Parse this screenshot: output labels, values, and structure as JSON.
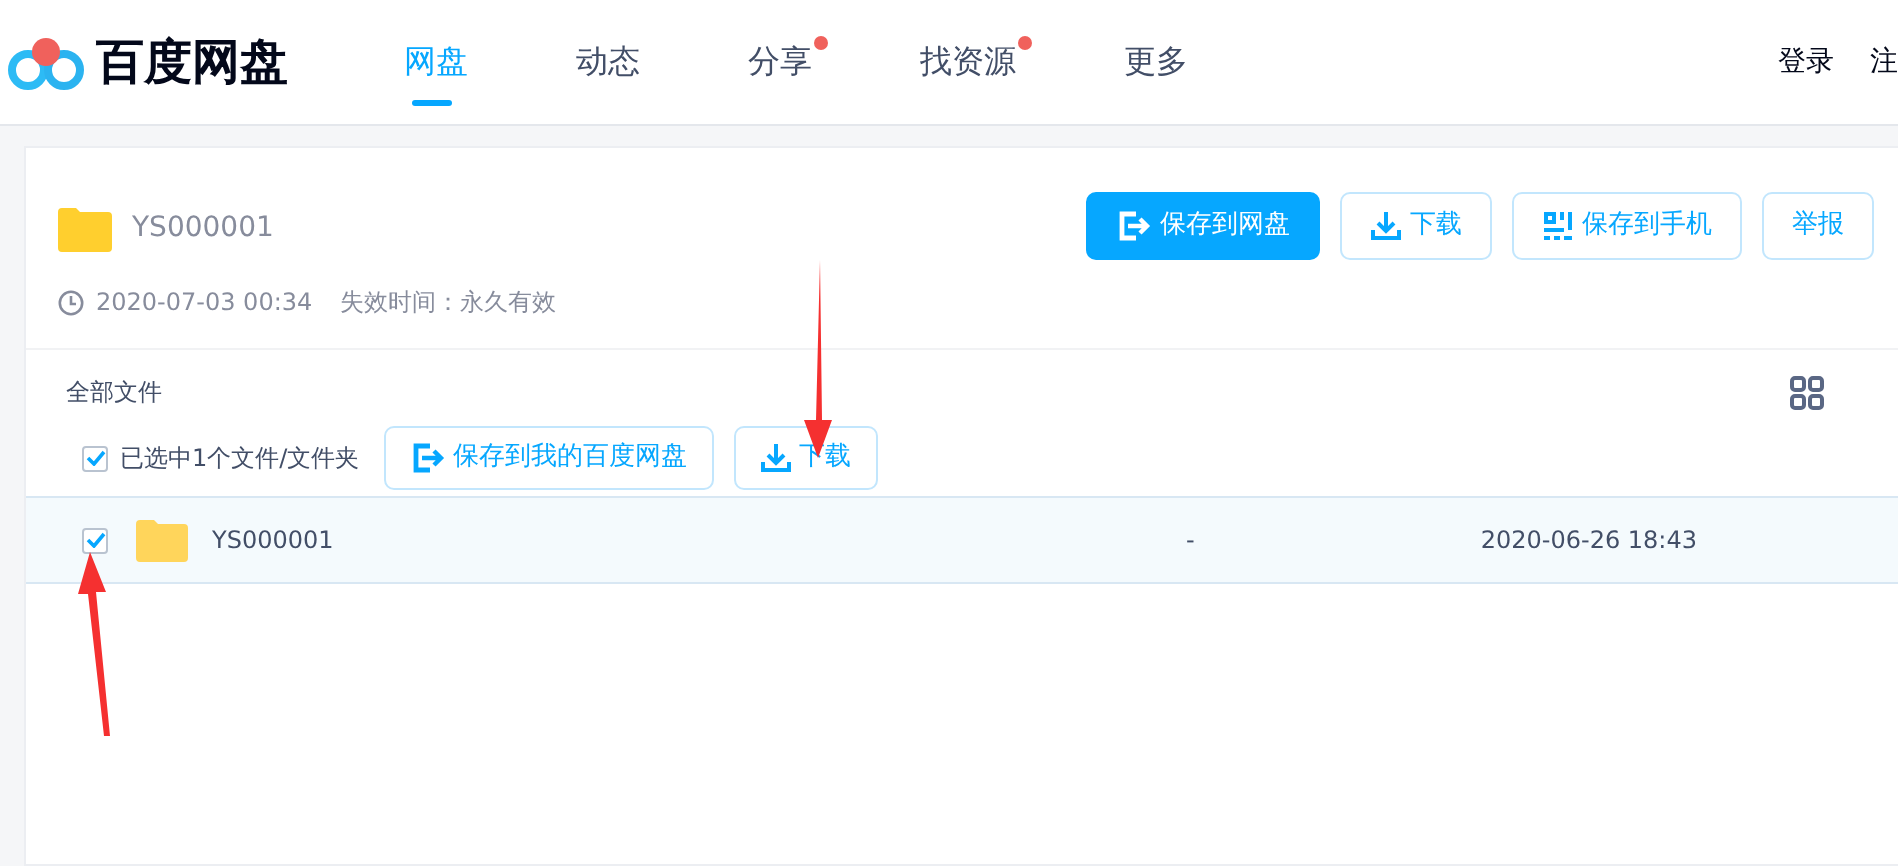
{
  "brand": "百度网盘",
  "nav": [
    {
      "label": "网盘",
      "selected": true,
      "dot": false
    },
    {
      "label": "动态",
      "selected": false,
      "dot": false
    },
    {
      "label": "分享",
      "selected": false,
      "dot": true
    },
    {
      "label": "找资源",
      "selected": false,
      "dot": true
    },
    {
      "label": "更多",
      "selected": false,
      "dot": false
    }
  ],
  "user_links": [
    "登录",
    "注"
  ],
  "share": {
    "name": "YS000001",
    "time": "2020-07-03 00:34",
    "expiry": "失效时间：永久有效",
    "actions": [
      {
        "label": "保存到网盘",
        "kind": "save",
        "primary": true
      },
      {
        "label": "下载",
        "kind": "download",
        "primary": false
      },
      {
        "label": "保存到手机",
        "kind": "qr",
        "primary": false
      },
      {
        "label": "举报",
        "kind": "plain",
        "primary": false
      }
    ]
  },
  "breadcrumb": "全部文件",
  "selection": {
    "checked": true,
    "label": "已选中1个文件/文件夹",
    "actions": [
      {
        "label": "保存到我的百度网盘",
        "kind": "save"
      },
      {
        "label": "下载",
        "kind": "download"
      }
    ]
  },
  "files": [
    {
      "name": "YS000001",
      "checked": true,
      "size": "-",
      "modified": "2020-06-26 18:43"
    }
  ]
}
